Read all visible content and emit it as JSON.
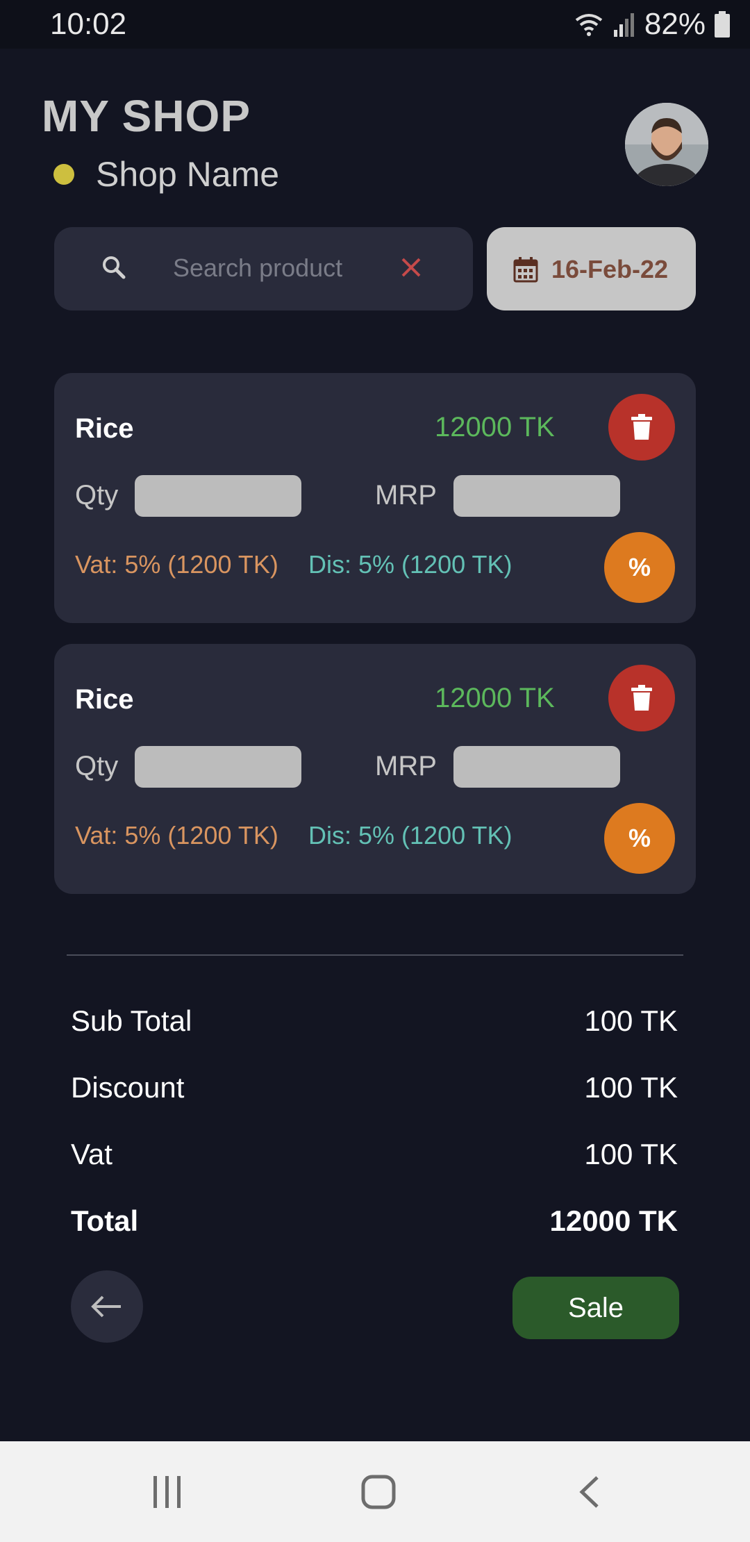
{
  "status_bar": {
    "time": "10:02",
    "battery": "82%"
  },
  "header": {
    "title": "MY SHOP",
    "shop_name": "Shop Name"
  },
  "search": {
    "placeholder": "Search product"
  },
  "date": {
    "value": "16-Feb-22"
  },
  "items": [
    {
      "name": "Rice",
      "price": "12000 TK",
      "qty_label": "Qty",
      "mrp_label": "MRP",
      "vat": "Vat: 5% (1200 TK)",
      "discount": "Dis: 5% (1200 TK)",
      "percent_button": "%"
    },
    {
      "name": "Rice",
      "price": "12000 TK",
      "qty_label": "Qty",
      "mrp_label": "MRP",
      "vat": "Vat: 5% (1200 TK)",
      "discount": "Dis: 5% (1200 TK)",
      "percent_button": "%"
    }
  ],
  "summary": {
    "sub_total_label": "Sub Total",
    "sub_total_value": "100 TK",
    "discount_label": "Discount",
    "discount_value": "100 TK",
    "vat_label": "Vat",
    "vat_value": "100 TK",
    "total_label": "Total",
    "total_value": "12000 TK"
  },
  "actions": {
    "sale_label": "Sale"
  },
  "colors": {
    "background": "#131522",
    "card": "#292b3b",
    "price_green": "#5cb85c",
    "delete_red": "#b8322a",
    "percent_orange": "#dd7a1f",
    "vat_text": "#d99560",
    "discount_text": "#63c1b5",
    "sale_green": "#2b5a2a",
    "date_text": "#7a4b3b"
  },
  "icons": [
    "wifi-icon",
    "signal-icon",
    "battery-icon",
    "search-icon",
    "clear-icon",
    "calendar-icon",
    "trash-icon",
    "back-arrow-icon",
    "recent-apps-icon",
    "home-icon",
    "nav-back-icon"
  ]
}
